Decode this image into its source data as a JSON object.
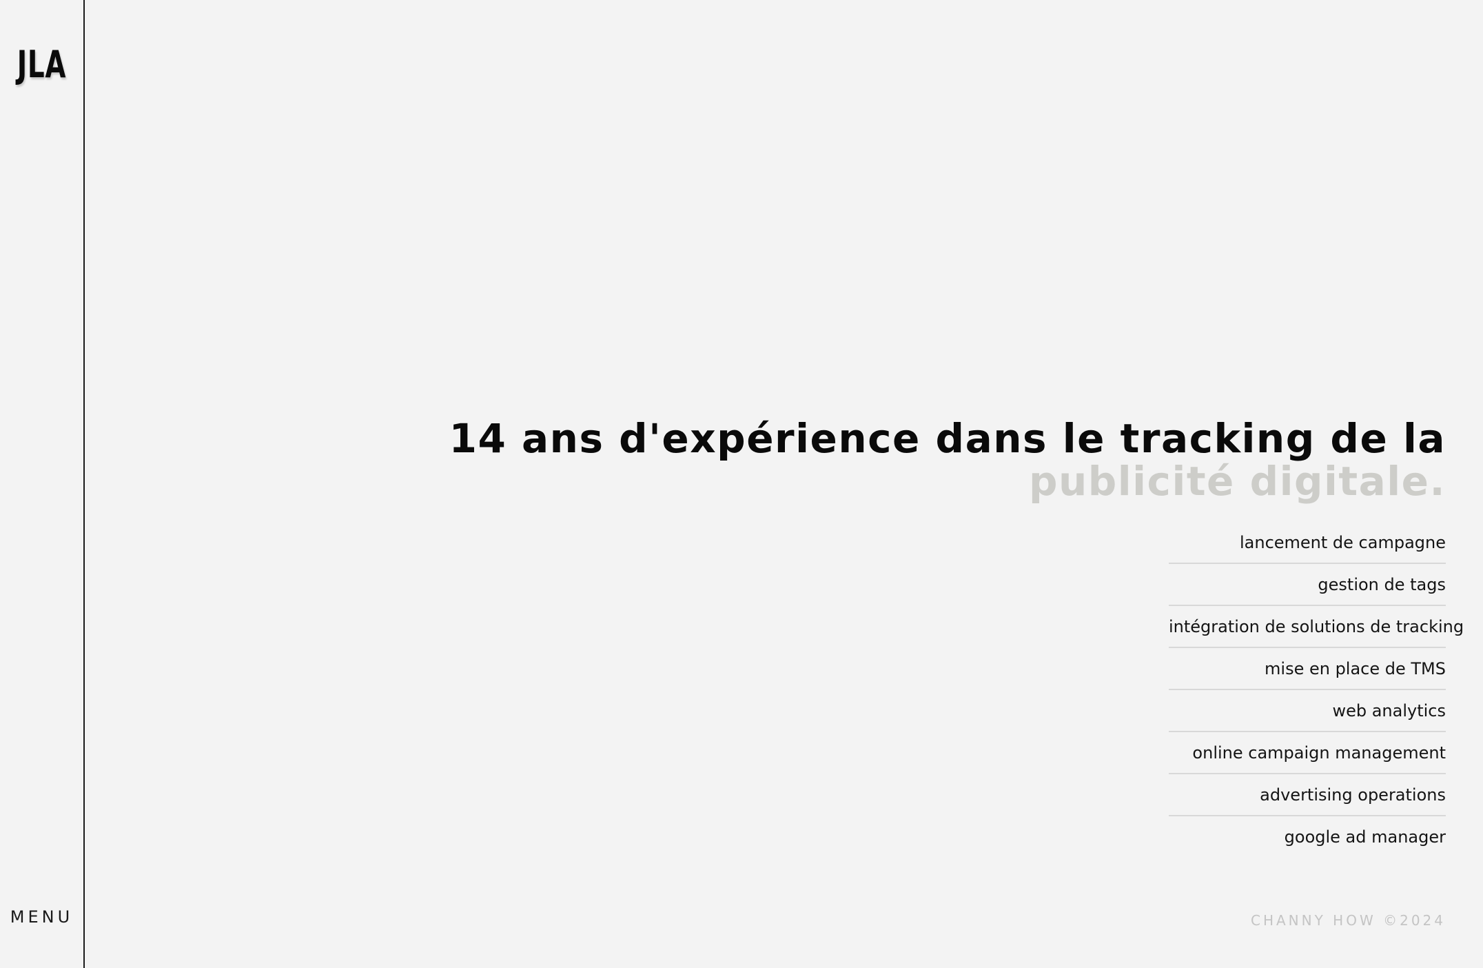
{
  "sidebar": {
    "logo": "JLA",
    "menu_label": "MENU"
  },
  "hero": {
    "headline_line1": "14 ans d'expérience dans le tracking de la",
    "headline_line2": "publicité digitale.",
    "headline_color": "#0a0a0a",
    "headline_accent_color": "#cdcdc9"
  },
  "skills": [
    {
      "label": "lancement de campagne"
    },
    {
      "label": "gestion de tags"
    },
    {
      "label": "intégration de solutions de tracking"
    },
    {
      "label": "mise en place de TMS"
    },
    {
      "label": "web analytics"
    },
    {
      "label": "online campaign management"
    },
    {
      "label": "advertising operations"
    },
    {
      "label": "google ad manager"
    }
  ],
  "footer": {
    "credit": "CHANNY HOW ©2024"
  },
  "theme": {
    "background": "#f3f3f3",
    "divider": "#d8d8d8"
  }
}
